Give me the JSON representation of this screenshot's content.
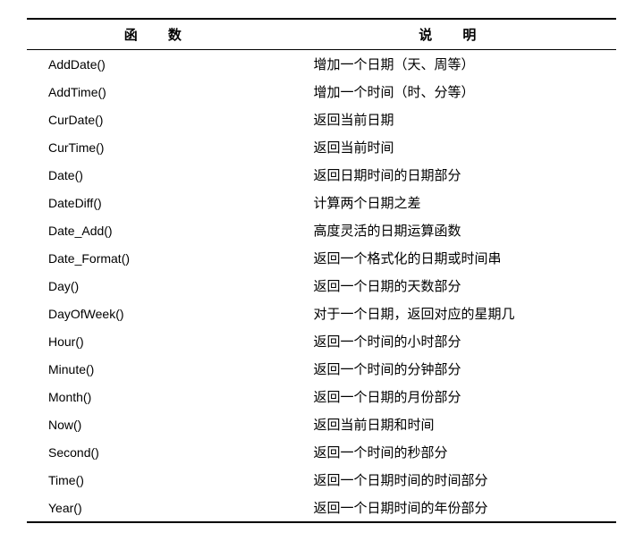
{
  "headers": {
    "function": "函 数",
    "description": "说 明"
  },
  "rows": [
    {
      "func": "AddDate()",
      "desc": "增加一个日期（天、周等）"
    },
    {
      "func": "AddTime()",
      "desc": "增加一个时间（时、分等）"
    },
    {
      "func": "CurDate()",
      "desc": "返回当前日期"
    },
    {
      "func": "CurTime()",
      "desc": "返回当前时间"
    },
    {
      "func": "Date()",
      "desc": "返回日期时间的日期部分"
    },
    {
      "func": "DateDiff()",
      "desc": "计算两个日期之差"
    },
    {
      "func": "Date_Add()",
      "desc": "高度灵活的日期运算函数"
    },
    {
      "func": "Date_Format()",
      "desc": "返回一个格式化的日期或时间串"
    },
    {
      "func": "Day()",
      "desc": "返回一个日期的天数部分"
    },
    {
      "func": "DayOfWeek()",
      "desc": "对于一个日期，返回对应的星期几"
    },
    {
      "func": "Hour()",
      "desc": "返回一个时间的小时部分"
    },
    {
      "func": "Minute()",
      "desc": "返回一个时间的分钟部分"
    },
    {
      "func": "Month()",
      "desc": "返回一个日期的月份部分"
    },
    {
      "func": "Now()",
      "desc": "返回当前日期和时间"
    },
    {
      "func": "Second()",
      "desc": "返回一个时间的秒部分"
    },
    {
      "func": "Time()",
      "desc": "返回一个日期时间的时间部分"
    },
    {
      "func": "Year()",
      "desc": "返回一个日期时间的年份部分"
    }
  ]
}
